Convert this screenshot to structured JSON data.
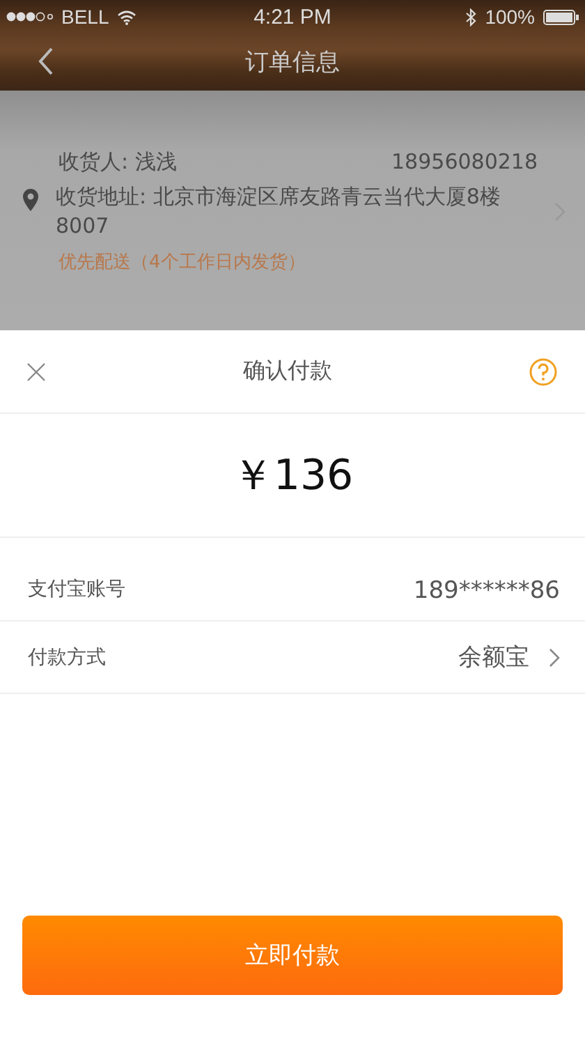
{
  "status_bar": {
    "carrier": "BELL",
    "time": "4:21 PM",
    "battery": "100%"
  },
  "nav": {
    "title": "订单信息"
  },
  "order": {
    "receiver_label": "收货人:",
    "receiver": "浅浅",
    "phone": "18956080218",
    "address_label": "收货地址:",
    "address": "北京市海淀区席友路青云当代大厦8楼8007",
    "delivery": "优先配送（4个工作日内发货）"
  },
  "sheet": {
    "title": "确认付款",
    "amount": "￥136",
    "rows": [
      {
        "label": "支付宝账号",
        "value": "189******86",
        "kind": "plain"
      },
      {
        "label": "付款方式",
        "value": "余额宝",
        "kind": "link"
      }
    ],
    "button": "立即付款"
  }
}
